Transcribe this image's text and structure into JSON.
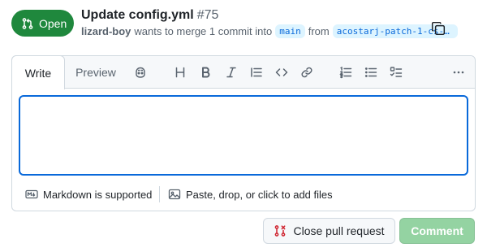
{
  "pr": {
    "state": "Open",
    "title": "Update config.yml",
    "number": "#75",
    "author": "lizard-boy",
    "merge_text": "wants to merge 1 commit into",
    "base_branch": "main",
    "from_text": "from",
    "head_branch": "acostarj-patch-1-cs-se…"
  },
  "tabs": {
    "write": "Write",
    "preview": "Preview"
  },
  "toolbar": {
    "icons": [
      "copilot-icon",
      "heading-icon",
      "bold-icon",
      "italic-icon",
      "quote-icon",
      "code-icon",
      "link-icon",
      "ordered-list-icon",
      "unordered-list-icon",
      "task-list-icon",
      "more-icon"
    ]
  },
  "editor": {
    "value": "",
    "placeholder": ""
  },
  "footer": {
    "markdown": "Markdown is supported",
    "attach": "Paste, drop, or click to add files"
  },
  "actions": {
    "close": "Close pull request",
    "comment": "Comment"
  },
  "colors": {
    "open_green": "#1f883d",
    "focus_blue": "#0969da",
    "close_red": "#cf222e",
    "comment_disabled": "#94d3a2"
  }
}
